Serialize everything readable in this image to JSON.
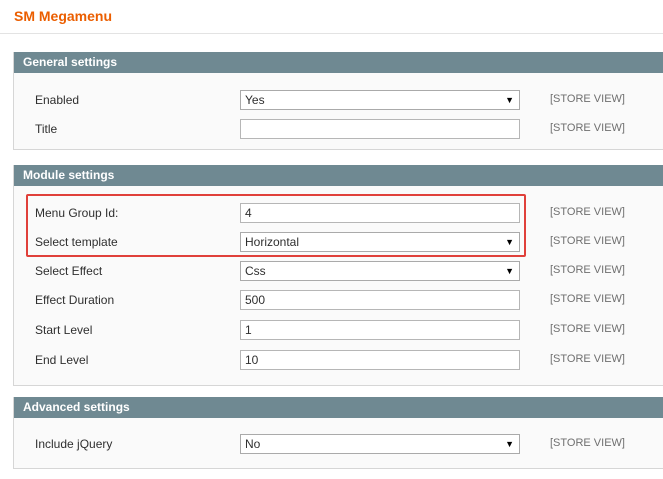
{
  "page": {
    "title": "SM Megamenu"
  },
  "scope_label": "[STORE VIEW]",
  "sections": {
    "general": {
      "title": "General settings",
      "enabled": {
        "label": "Enabled",
        "value": "Yes"
      },
      "title_field": {
        "label": "Title",
        "value": ""
      }
    },
    "module": {
      "title": "Module settings",
      "menu_group_id": {
        "label": "Menu Group Id:",
        "value": "4"
      },
      "select_template": {
        "label": "Select template",
        "value": "Horizontal"
      },
      "select_effect": {
        "label": "Select Effect",
        "value": "Css"
      },
      "effect_duration": {
        "label": "Effect Duration",
        "value": "500"
      },
      "start_level": {
        "label": "Start Level",
        "value": "1"
      },
      "end_level": {
        "label": "End Level",
        "value": "10"
      }
    },
    "advanced": {
      "title": "Advanced settings",
      "include_jquery": {
        "label": "Include jQuery",
        "value": "No"
      }
    }
  },
  "colors": {
    "title": "#eb5e00",
    "section_header": "#6f8992",
    "highlight": "#e0403a"
  },
  "icons": {
    "select_arrow": "chevron-down-icon"
  }
}
